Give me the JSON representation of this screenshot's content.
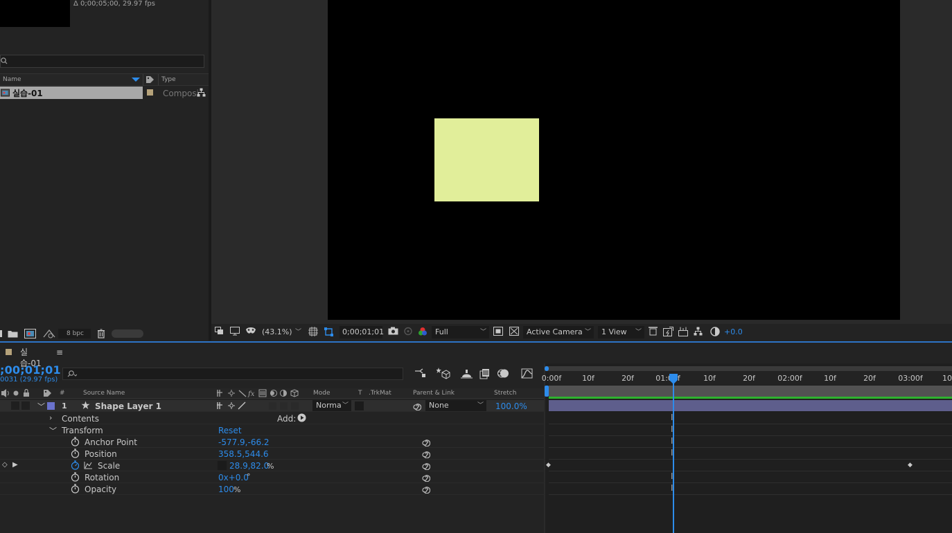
{
  "project": {
    "comp_info": "Δ 0;00;05;00, 29.97 fps",
    "columns": {
      "name": "Name",
      "type": "Type"
    },
    "items": [
      {
        "name": "실습-01",
        "type": "Composi"
      }
    ],
    "bit_depth": "8 bpc"
  },
  "viewer": {
    "zoom": "(43.1%)",
    "timecode": "0;00;01;01",
    "resolution": "Full",
    "camera": "Active Camera",
    "views": "1 View",
    "exposure": "+0.0",
    "shape_color": "#e1ee9a"
  },
  "timeline": {
    "comp_tab": "실습-01",
    "timecode": ";00;01;01",
    "frame_info": "0031 (29.97 fps)",
    "columns": {
      "num": "#",
      "source_name": "Source Name",
      "mode": "Mode",
      "t": "T",
      "trkmat": ".TrkMat",
      "parent": "Parent & Link",
      "stretch": "Stretch"
    },
    "layer": {
      "number": "1",
      "name": "Shape Layer 1",
      "mode": "Norma",
      "parent": "None",
      "stretch": "100.0%",
      "label_color": "#6a72cc"
    },
    "contents_label": "Contents",
    "add_label": "Add:",
    "transform_label": "Transform",
    "reset_label": "Reset",
    "properties": [
      {
        "name": "Anchor Point",
        "value": "-577.9,-66.2",
        "unit": ""
      },
      {
        "name": "Position",
        "value": "358.5,544.6",
        "unit": ""
      },
      {
        "name": "Scale",
        "value": "28.9,82.0",
        "unit": "%"
      },
      {
        "name": "Rotation",
        "value": "0x+0.0",
        "unit": "°"
      },
      {
        "name": "Opacity",
        "value": "100",
        "unit": "%"
      }
    ],
    "ruler_ticks": [
      "0:00f",
      "10f",
      "20f",
      "01:00f",
      "10f",
      "20f",
      "02:00f",
      "10f",
      "20f",
      "03:00f",
      "10"
    ]
  }
}
